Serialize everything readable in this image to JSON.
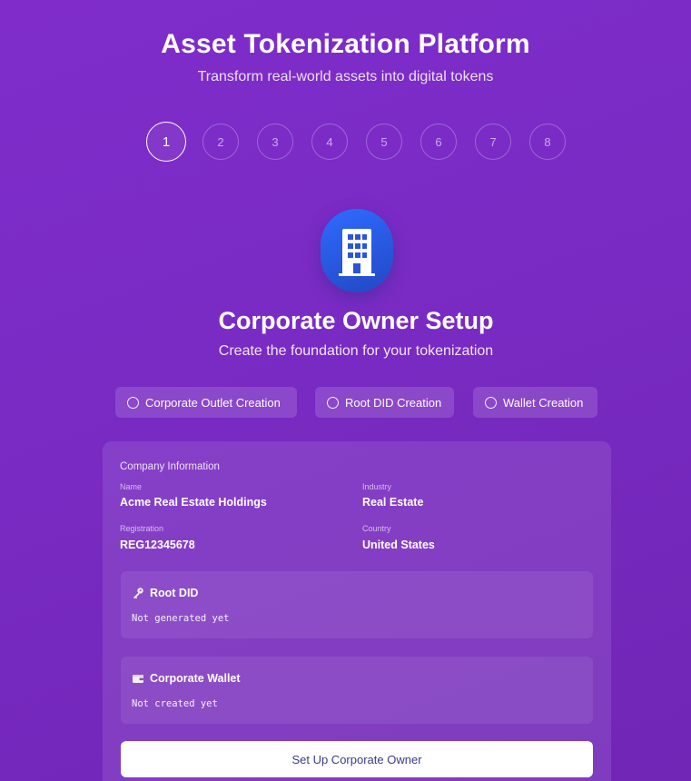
{
  "header": {
    "title": "Asset Tokenization Platform",
    "subtitle": "Transform real-world assets into digital tokens"
  },
  "steps": [
    {
      "label": "1",
      "active": true
    },
    {
      "label": "2",
      "active": false
    },
    {
      "label": "3",
      "active": false
    },
    {
      "label": "4",
      "active": false
    },
    {
      "label": "5",
      "active": false
    },
    {
      "label": "6",
      "active": false
    },
    {
      "label": "7",
      "active": false
    },
    {
      "label": "8",
      "active": false
    }
  ],
  "hero": {
    "icon": "building-icon"
  },
  "section": {
    "title": "Corporate Owner Setup",
    "subtitle": "Create the foundation for your tokenization"
  },
  "chips": [
    {
      "label": "Corporate Outlet Creation",
      "done": false
    },
    {
      "label": "Root DID Creation",
      "done": false
    },
    {
      "label": "Wallet Creation",
      "done": false
    }
  ],
  "company": {
    "heading": "Company Information",
    "name_label": "Name",
    "name": "Acme Real Estate Holdings",
    "industry_label": "Industry",
    "industry": "Real Estate",
    "registration_label": "Registration",
    "registration": "REG12345678",
    "country_label": "Country",
    "country": "United States"
  },
  "root_did": {
    "icon": "key-icon",
    "title": "Root DID",
    "value": "Not generated yet"
  },
  "wallet": {
    "icon": "wallet-icon",
    "title": "Corporate Wallet",
    "value": "Not created yet"
  },
  "action": {
    "label": "Set Up Corporate Owner"
  },
  "colors": {
    "background": "#7b2bc6",
    "hero_icon": "#2a5be6",
    "button_text": "#3a3a8c"
  }
}
